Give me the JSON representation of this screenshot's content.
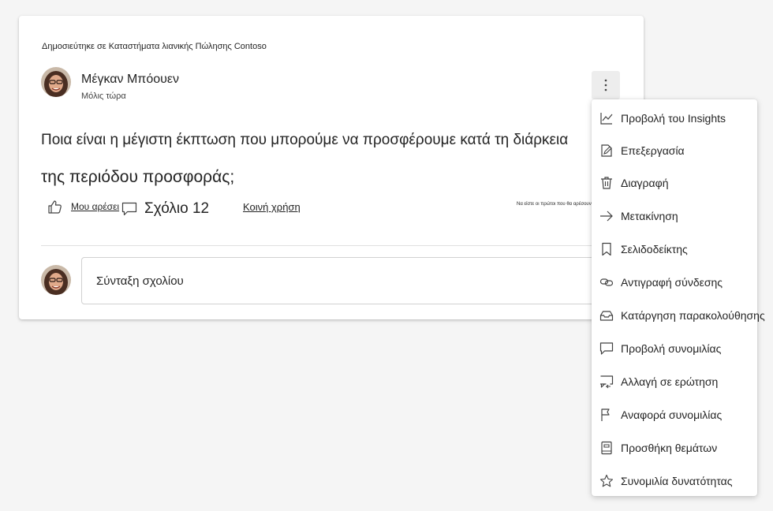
{
  "post": {
    "posted_in": "Δημοσιεύτηκε σε Καταστήματα λιανικής Πώλησης Contoso",
    "author_name": "Μέγκαν Μπόουεν",
    "time": "Μόλις τώρα",
    "question_line1": "Ποια είναι η μέγιστη έκπτωση που μπορούμε να προσφέρουμε κατά τη διάρκεια",
    "question_line2": "της περιόδου προσφοράς;"
  },
  "actions": {
    "like_label": "Μου αρέσει",
    "comment_label": "Σχόλιο 12",
    "share_label": "Κοινή χρήση",
    "first_like_text": "Να είστε οι πρώτοι που θα αρέσουν αυτό"
  },
  "composer": {
    "placeholder": "Σύνταξη σχολίου"
  },
  "menu": {
    "items": [
      {
        "label": "Προβολή του Insights",
        "icon": "insights-chart-icon"
      },
      {
        "label": "Επεξεργασία",
        "icon": "edit-icon"
      },
      {
        "label": "Διαγραφή",
        "icon": "trash-icon"
      },
      {
        "label": "Μετακίνηση",
        "icon": "arrow-right-icon"
      },
      {
        "label": "Σελιδοδείκτης",
        "icon": "bookmark-icon"
      },
      {
        "label": "Αντιγραφή σύνδεσης",
        "icon": "link-icon"
      },
      {
        "label": "Κατάργηση παρακολούθησης",
        "icon": "inbox-icon"
      },
      {
        "label": "Προβολή συνομιλίας",
        "icon": "chat-icon"
      },
      {
        "label": "Αλλαγή σε ερώτηση",
        "icon": "chat-swap-icon"
      },
      {
        "label": "Αναφορά συνομιλίας",
        "icon": "flag-icon"
      },
      {
        "label": "Προσθήκη θεμάτων",
        "icon": "notebook-icon"
      },
      {
        "label": "Συνομιλία δυνατότητας",
        "icon": "star-icon"
      }
    ]
  },
  "colors": {
    "background": "#f5f5f5",
    "card": "#ffffff",
    "text": "#242424"
  }
}
